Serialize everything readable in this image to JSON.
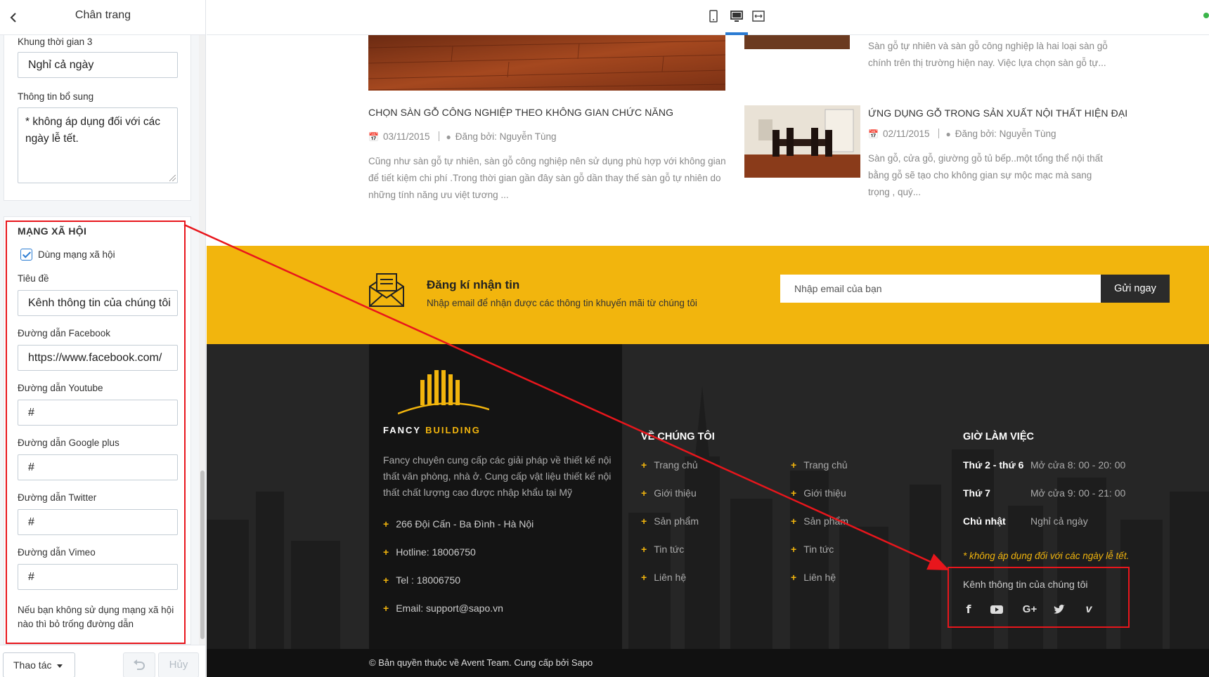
{
  "panel": {
    "title": "Chân trang",
    "time3_label": "Khung thời gian 3",
    "time3_value": "Nghỉ cả ngày",
    "extra_label": "Thông tin bổ sung",
    "extra_value": "* không áp dụng đối với các ngày lễ tết.",
    "social_section_title": "MẠNG XÃ HỘI",
    "use_social_label": "Dùng mạng xã hội",
    "use_social_checked": true,
    "title_label": "Tiêu đề",
    "title_value": "Kênh thông tin của chúng tôi",
    "facebook_label": "Đường dẫn Facebook",
    "facebook_value": "https://www.facebook.com/",
    "youtube_label": "Đường dẫn Youtube",
    "youtube_value": "#",
    "google_label": "Đường dẫn Google plus",
    "google_value": "#",
    "twitter_label": "Đường dẫn Twitter",
    "twitter_value": "#",
    "vimeo_label": "Đường dẫn Vimeo",
    "vimeo_value": "#",
    "hint": "Nếu bạn không sử dụng mạng xã hội nào thì bỏ trống đường dẫn",
    "actions_label": "Thao tác",
    "cancel_label": "Hủy"
  },
  "preview": {
    "devices": [
      "mobile-icon",
      "desktop-icon",
      "fullwidth-icon"
    ],
    "active_device": "desktop-icon",
    "articles": [
      {
        "title": "CHỌN SÀN GỖ CÔNG NGHIỆP THEO KHÔNG GIAN CHỨC NĂNG",
        "date": "03/11/2015",
        "author": "Đăng bởi: Nguyễn Tùng",
        "desc": "Cũng như sàn gỗ tự nhiên, sàn gỗ công nghiệp nên sử dụng phù hợp với không gian để tiết kiệm chi phí .Trong thời gian gần đây sàn gỗ dần thay thế sàn gỗ tự nhiên do những tính năng ưu việt tương ..."
      },
      {
        "title": "ỨNG DỤNG GỖ TRONG SẢN XUẤT NỘI THẤT HIỆN ĐẠI",
        "date": "02/11/2015",
        "author": "Đăng bởi: Nguyễn Tùng",
        "desc": "Sàn gỗ, cửa gỗ, giường gỗ tủ bếp..một tổng thể nội thất bằng gỗ sẽ tạo cho không gian sự mộc mạc mà sang trọng , quý..."
      }
    ],
    "top_article_desc": "Sàn gỗ tự nhiên và sàn gỗ công nghiệp là hai loại sàn gỗ chính trên thị trường hiện nay. Việc lựa chọn sàn gỗ tự...",
    "newsletter": {
      "title": "Đăng kí nhận tin",
      "subtitle": "Nhập email để nhận được các thông tin khuyến mãi từ chúng tôi",
      "placeholder": "Nhập email của bạn",
      "button": "Gửi ngay"
    },
    "footer": {
      "brand_1": "FANCY",
      "brand_2": "BUILDING",
      "about": "Fancy chuyên cung cấp các giải pháp về thiết kế nội thất văn phòng, nhà ở. Cung cấp vật liệu thiết kế nội thất chất lượng cao được nhập khẩu tại Mỹ",
      "contacts": [
        "266 Đội Cấn - Ba Đình - Hà Nội",
        "Hotline: 18006750",
        "Tel : 18006750",
        "Email: support@sapo.vn"
      ],
      "about_heading": "VỀ CHÚNG TÔI",
      "links_col1": [
        "Trang chủ",
        "Giới thiệu",
        "Sản phẩm",
        "Tin tức",
        "Liên hệ"
      ],
      "links_col2": [
        "Trang chủ",
        "Giới thiệu",
        "Sản phẩm",
        "Tin tức",
        "Liên hệ"
      ],
      "hours_heading": "GIỜ LÀM VIỆC",
      "hours": [
        {
          "day": "Thứ 2 - thứ 6",
          "value": "Mở cửa 8: 00 - 20: 00"
        },
        {
          "day": "Thứ 7",
          "value": "Mở cửa 9: 00 - 21: 00"
        },
        {
          "day": "Chủ nhật",
          "value": "Nghỉ cả ngày"
        }
      ],
      "hours_note": "* không áp dụng đối với các ngày lễ tết.",
      "social_title": "Kênh thông tin của chúng tôi",
      "social_icons": [
        "facebook-icon",
        "youtube-icon",
        "google-plus-icon",
        "twitter-icon",
        "vimeo-icon"
      ],
      "copyright": "© Bản quyền thuộc về Avent Team. Cung cấp bởi Sapo"
    },
    "colors": {
      "accent": "#f2b50d",
      "footer_bg": "#242424",
      "annotation": "#e8161c",
      "link_blue": "#2b7cd3"
    }
  }
}
